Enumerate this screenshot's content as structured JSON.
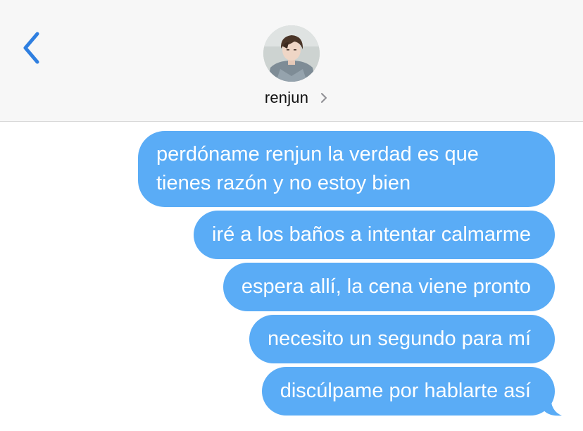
{
  "header": {
    "back_icon": "chevron-left-icon",
    "contact_name": "renjun",
    "disclosure_icon": "chevron-right-icon"
  },
  "messages": [
    "perdóname renjun la verdad es que tienes razón y no estoy bien",
    "iré a los baños a intentar calmarme",
    "espera allí, la cena viene pronto",
    "necesito un segundo para mí",
    "discúlpame por hablarte así"
  ],
  "colors": {
    "bubble": "#5aacf6",
    "accent": "#2f7fe0",
    "header_bg": "#f7f7f7"
  }
}
